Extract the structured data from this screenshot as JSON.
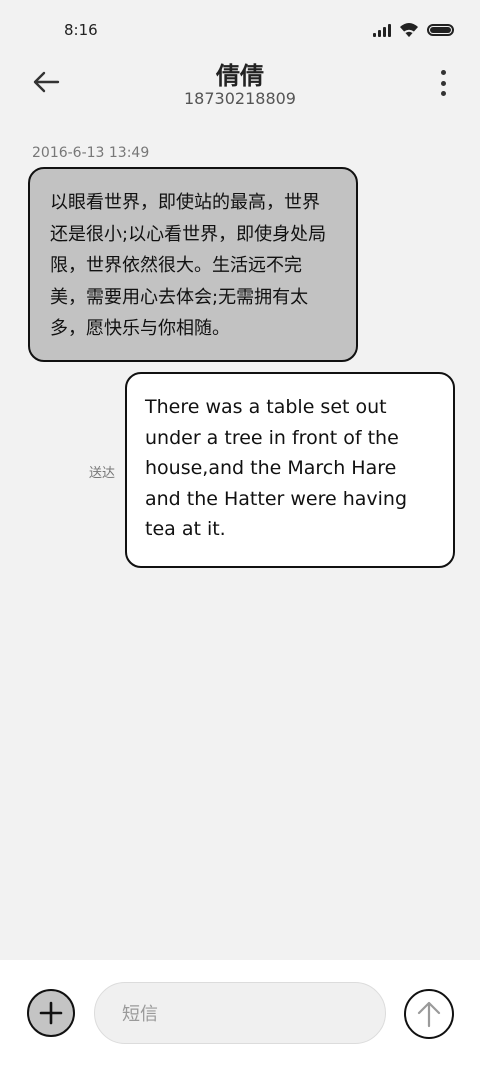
{
  "status_bar": {
    "time": "8:16",
    "icons": [
      "signal-icon",
      "wifi-icon",
      "battery-icon"
    ]
  },
  "header": {
    "back_icon": "arrow-left-icon",
    "contact_name": "倩倩",
    "contact_number": "18730218809",
    "more_icon": "more-vertical-icon"
  },
  "conversation": {
    "timestamp": "2016-6-13 13:49",
    "messages": [
      {
        "direction": "incoming",
        "text": "以眼看世界，即使站的最高，世界还是很小;以心看世界，即使身处局限，世界依然很大。生活远不完美，需要用心去体会;无需拥有太多，愿快乐与你相随。"
      },
      {
        "direction": "outgoing",
        "status": "送达",
        "text": "There was a table set out under a tree in front of the house,and the March Hare and the Hatter were having tea at it."
      }
    ]
  },
  "composer": {
    "add_icon": "plus-icon",
    "placeholder": "短信",
    "send_icon": "arrow-up-icon"
  },
  "colors": {
    "background": "#f2f2f2",
    "incoming_bubble": "#c2c2c2",
    "outgoing_bubble": "#ffffff",
    "border": "#111111"
  }
}
